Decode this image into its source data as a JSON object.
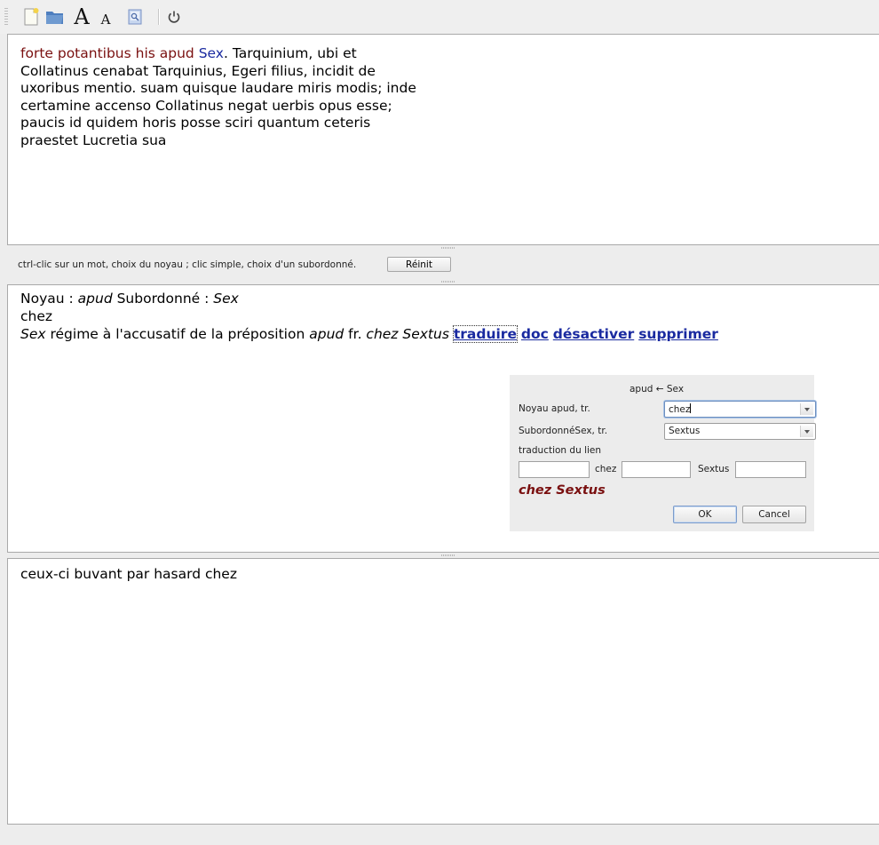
{
  "toolbar": {
    "items": [
      {
        "name": "new-file-icon"
      },
      {
        "name": "open-folder-icon"
      },
      {
        "name": "font-larger-icon",
        "glyph": "A"
      },
      {
        "name": "font-smaller-icon",
        "glyph": "A"
      },
      {
        "name": "preview-icon"
      },
      {
        "name": "power-icon",
        "glyph": "⏻"
      }
    ]
  },
  "latin": {
    "segments": [
      {
        "text": "forte potantibus his apud ",
        "style": "red"
      },
      {
        "text": "Sex",
        "style": "blue"
      },
      {
        "text": ". Tarquinium, ubi et\nCollatinus cenabat Tarquinius, Egeri filius, incidit de\nuxoribus mentio. suam quisque laudare miris modis; inde\ncertamine accenso Collatinus negat uerbis opus esse;\npaucis id quidem horis posse sciri quantum ceteris\npraestet Lucretia sua",
        "style": "plain"
      }
    ]
  },
  "instructions": {
    "text": "ctrl-clic sur un mot, choix du noyau ; clic simple, choix d'un subordonné.",
    "reset_button": "Réinit"
  },
  "analysis": {
    "noyau_label": "Noyau : ",
    "noyau_word": "apud",
    "sub_label": " Subordonné : ",
    "sub_word": "Sex",
    "translation_line": "chez",
    "rule_word": "Sex",
    "rule_text": " régime à l'accusatif de la préposition ",
    "rule_prep": "apud",
    "rule_fr": " fr. ",
    "rule_example": "chez Sextus",
    "links": [
      "traduire",
      "doc",
      "désactiver",
      "supprimer"
    ]
  },
  "dialog": {
    "header": "apud ← Sex",
    "noyau_label": "Noyau apud, tr.",
    "noyau_value": "chez",
    "sub_label": "SubordonnéSex, tr.",
    "sub_value": "Sextus",
    "link_label": "traduction du lien",
    "word1": "chez",
    "word2": "Sextus",
    "field_before": "",
    "field_between": "",
    "field_after": "",
    "result": "chez Sextus",
    "ok": "OK",
    "cancel": "Cancel"
  },
  "translation": {
    "text": "ceux-ci buvant par hasard chez"
  },
  "colors": {
    "accent_red": "#7a1010",
    "link_blue": "#1a2aa0"
  }
}
